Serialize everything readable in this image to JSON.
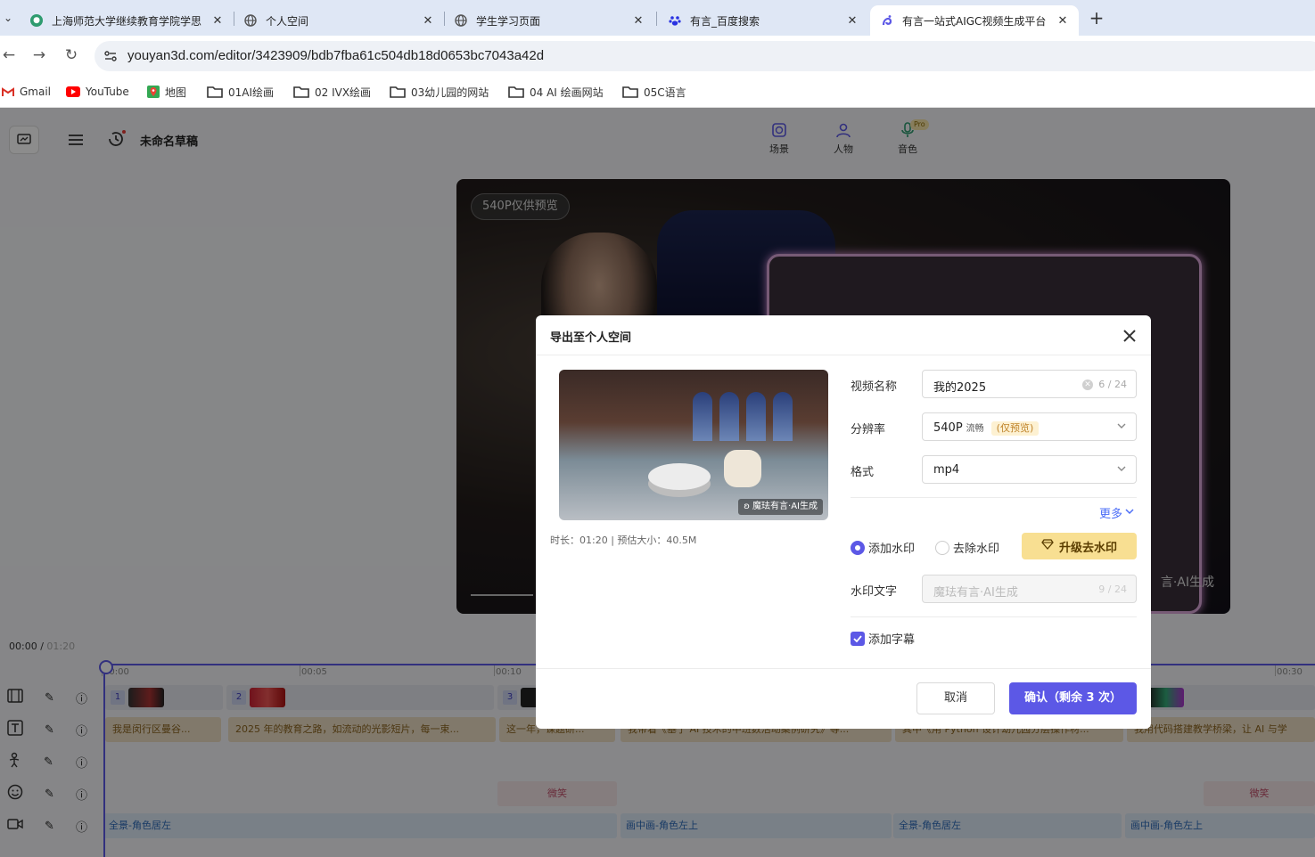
{
  "browser": {
    "tabs": [
      {
        "title": "上海师范大学继续教育学院学思",
        "favicon": "green-circle-icon"
      },
      {
        "title": "个人空间",
        "favicon": "globe-icon"
      },
      {
        "title": "学生学习页面",
        "favicon": "globe-icon"
      },
      {
        "title": "有言_百度搜索",
        "favicon": "baidu-paw-icon"
      },
      {
        "title": "有言一站式AIGC视频生成平台",
        "favicon": "youyan-icon"
      }
    ],
    "url": "youyan3d.com/editor/3423909/bdb7fba61c504db18d0653bc7043a42d",
    "bookmarks": [
      {
        "label": "Gmail",
        "icon": "gmail-icon"
      },
      {
        "label": "YouTube",
        "icon": "youtube-icon"
      },
      {
        "label": "地图",
        "icon": "maps-icon"
      },
      {
        "label": "01AI绘画",
        "icon": "folder-icon"
      },
      {
        "label": "02 IVX绘画",
        "icon": "folder-icon"
      },
      {
        "label": "03幼儿园的网站",
        "icon": "folder-icon"
      },
      {
        "label": "04 AI 绘画网站",
        "icon": "folder-icon"
      },
      {
        "label": "05C语言",
        "icon": "folder-icon"
      }
    ]
  },
  "editor": {
    "draft_title": "未命名草稿",
    "topnav": [
      {
        "label": "场景",
        "icon": "scene-icon"
      },
      {
        "label": "人物",
        "icon": "person-icon"
      },
      {
        "label": "音色",
        "icon": "mic-icon"
      }
    ],
    "pro_badge": "Pro",
    "preview_badge": "540P仅供预览",
    "preview_watermark": "言·AI生成",
    "current_time": "00:00 /",
    "total_time": "01:20",
    "ruler_ticks": [
      "00:00",
      "00:05",
      "00:10",
      "00:30"
    ],
    "video_clips": [
      "1",
      "2",
      "3"
    ],
    "subtitle_clips": [
      "我是闵行区曼谷...",
      "2025 年的教育之路，如流动的光影短片，每一束...",
      "这一年，课题研...",
      "我带着《基于 AI 技术的中班数活动案例研究》等...",
      "其中《用 Python 设计幼儿园分层操作材...",
      "我用代码搭建教学桥梁，让 AI 与学"
    ],
    "emotion_clips": [
      "微笑",
      "微笑"
    ],
    "camera_clips": [
      "全景-角色居左",
      "画中画-角色左上",
      "全景-角色居左",
      "画中画-角色左上"
    ]
  },
  "modal": {
    "title": "导出至个人空间",
    "thumb_watermark": "魔珐有言·AI生成",
    "meta": "时长：01:20 | 预估大小：40.5M",
    "name_label": "视频名称",
    "name_value": "我的2025",
    "name_counter": "6 / 24",
    "resolution_label": "分辨率",
    "resolution_value": "540P",
    "resolution_sub": "流畅",
    "resolution_tag": "(仅预览)",
    "format_label": "格式",
    "format_value": "mp4",
    "more_label": "更多",
    "watermark_add": "添加水印",
    "watermark_remove": "去除水印",
    "upgrade_label": "升级去水印",
    "watermark_text_label": "水印文字",
    "watermark_text_placeholder": "魔珐有言·AI生成",
    "watermark_counter": "9 / 24",
    "subtitle_label": "添加字幕",
    "cancel_label": "取消",
    "confirm_label": "确认（剩余 3 次）"
  },
  "colors": {
    "accent": "#5c58e6",
    "upgrade": "#f8df92",
    "link": "#4a6cf7"
  }
}
